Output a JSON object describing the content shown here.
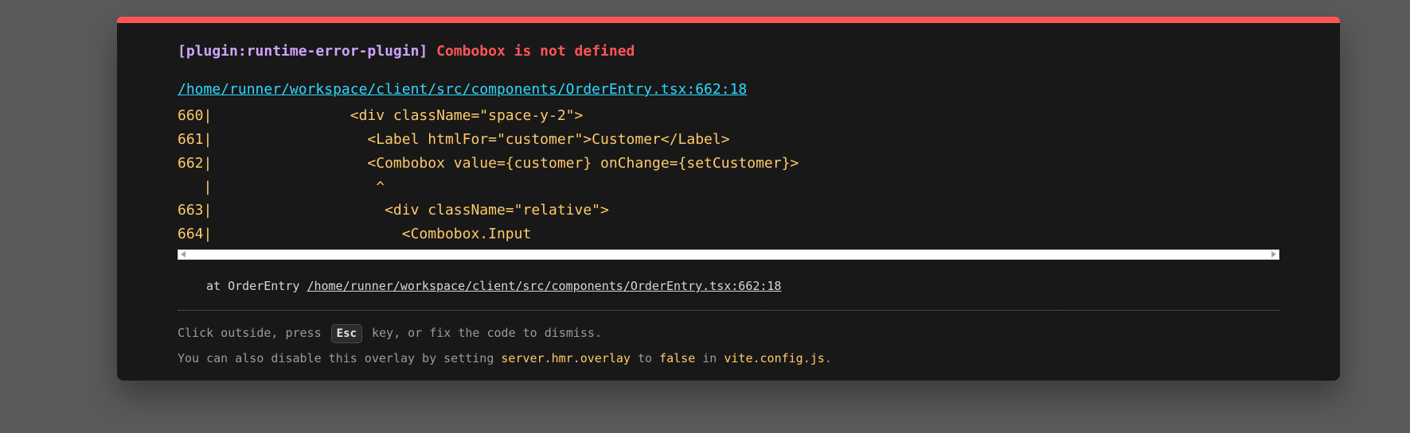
{
  "overlay": {
    "plugin_tag": "[plugin:runtime-error-plugin]",
    "error_message": "Combobox is not defined",
    "file_location": "/home/runner/workspace/client/src/components/OrderEntry.tsx:662:18",
    "code_frame": [
      "660|                <div className=\"space-y-2\">",
      "661|                  <Label htmlFor=\"customer\">Customer</Label>",
      "662|                  <Combobox value={customer} onChange={setCustomer}>",
      "   |                   ^",
      "663|                    <div className=\"relative\">",
      "664|                      <Combobox.Input"
    ],
    "stack": {
      "prefix": "at OrderEntry",
      "link": "/home/runner/workspace/client/src/components/OrderEntry.tsx:662:18"
    },
    "tip": {
      "line1_before": "Click outside, press",
      "esc_key": "Esc",
      "line1_after": "key, or fix the code to dismiss.",
      "line2_a": "You can also disable this overlay by setting",
      "line2_code1": "server.hmr.overlay",
      "line2_b": "to",
      "line2_code2": "false",
      "line2_c": "in",
      "line2_code3": "vite.config.js",
      "line2_d": "."
    }
  },
  "colors": {
    "accent_bar": "#ff5555",
    "plugin": "#cfa4ff",
    "message": "#ff5555",
    "file_link": "#2dd9fe",
    "code": "#ffcb6b"
  }
}
